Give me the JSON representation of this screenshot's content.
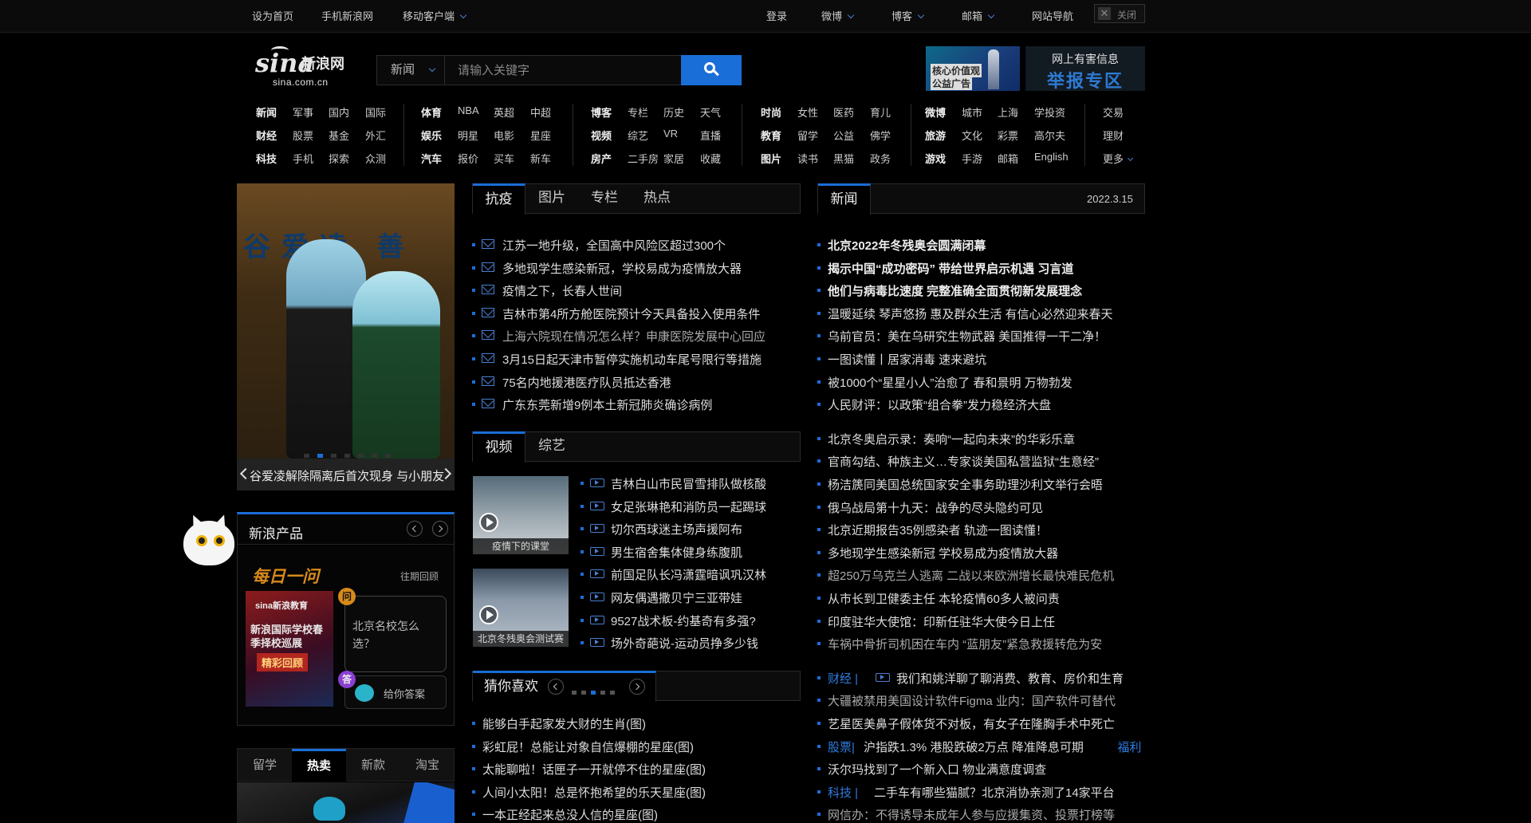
{
  "topbar": {
    "set_home": "设为首页",
    "mobile_sina": "手机新浪网",
    "mobile_client": "移动客户端",
    "login": "登录",
    "weibo": "微博",
    "blog": "博客",
    "mail": "邮箱",
    "site_nav": "网站导航",
    "close": "关闭"
  },
  "logo": {
    "brand": "sina",
    "cn": "新浪网",
    "domain": "sina.com.cn"
  },
  "search": {
    "category": "新闻",
    "placeholder": "请输入关键字"
  },
  "ads": {
    "ad1_line1": "核心价值观",
    "ad1_line2": "公益广告",
    "ad2_line1": "网上有害信息",
    "ad2_line2": "举报专区"
  },
  "nav": {
    "g1": [
      [
        "新闻",
        "军事",
        "国内",
        "国际"
      ],
      [
        "财经",
        "股票",
        "基金",
        "外汇"
      ],
      [
        "科技",
        "手机",
        "探索",
        "众测"
      ]
    ],
    "g2": [
      [
        "体育",
        "NBA",
        "英超",
        "中超"
      ],
      [
        "娱乐",
        "明星",
        "电影",
        "星座"
      ],
      [
        "汽车",
        "报价",
        "买车",
        "新车"
      ]
    ],
    "g3": [
      [
        "博客",
        "专栏",
        "历史",
        "天气"
      ],
      [
        "视频",
        "综艺",
        "VR",
        "直播"
      ],
      [
        "房产",
        "二手房",
        "家居",
        "收藏"
      ]
    ],
    "g4": [
      [
        "时尚",
        "女性",
        "医药",
        "育儿"
      ],
      [
        "教育",
        "留学",
        "公益",
        "佛学"
      ],
      [
        "图片",
        "读书",
        "黑猫",
        "政务"
      ]
    ],
    "g5": [
      [
        "微博",
        "城市",
        "上海",
        "学投资"
      ],
      [
        "旅游",
        "文化",
        "彩票",
        "高尔夫"
      ],
      [
        "游戏",
        "手游",
        "邮箱",
        "English"
      ]
    ],
    "g6": [
      "交易",
      "理财",
      "更多"
    ]
  },
  "slideshow": {
    "banner": "谷爱凌 善",
    "caption": "谷爱凌解除隔离后首次现身 与小朋友合影",
    "active_index": 1,
    "count": 7
  },
  "products": {
    "title": "新浪产品",
    "daily": "每日一问",
    "past": "往期回顾",
    "poster_brand": "sina新浪教育",
    "poster_title": "新浪国际学校春季择校巡展",
    "poster_tag": "精彩回顾",
    "question_badge": "问",
    "answer_badge": "答",
    "question": "北京名校怎么选？",
    "answer": "给你答案"
  },
  "shop_tabs": [
    "留学",
    "热卖",
    "新款",
    "淘宝"
  ],
  "shop_active": 1,
  "center": {
    "tabs": [
      "抗疫",
      "图片",
      "专栏",
      "热点"
    ],
    "news": [
      "江苏一地升级，全国高中风险区超过300个",
      "多地现学生感染新冠，学校易成为疫情放大器",
      "疫情之下，长春人世间",
      "吉林市第4所方舱医院预计今天具备投入使用条件",
      "上海六院现在情况怎么样？申康医院发展中心回应",
      "3月15日起天津市暂停实施机动车尾号限行等措施",
      "75名内地援港医疗队员抵达香港",
      "广东东莞新增9例本土新冠肺炎确诊病例"
    ],
    "video_tabs": [
      "视频",
      "综艺"
    ],
    "video_thumbs": [
      "疫情下的课堂",
      "北京冬残奥会测试赛"
    ],
    "videos": [
      "吉林白山市民冒雪排队做核酸",
      "女足张琳艳和消防员一起踢球",
      "切尔西球迷主场声援阿布",
      "男生宿舍集体健身练腹肌",
      "前国足队长冯潇霆暗讽巩汉林",
      "网友偶遇撒贝宁三亚带娃",
      "9527战术板-约基奇有多强?",
      "场外奇葩说-运动员挣多少钱"
    ],
    "guess_title": "猜你喜欢",
    "guess": [
      "能够白手起家发大财的生肖(图)",
      "彩虹屁！总能让对象自信爆棚的星座(图)",
      "太能聊啦！话匣子一开就停不住的星座(图)",
      "人间小太阳！总是怀抱希望的乐天星座(图)",
      "一本正经起来总没人信的星座(图)"
    ]
  },
  "right": {
    "tab": "新闻",
    "date": "2022.3.15",
    "block1": [
      {
        "t": "北京2022年冬残奥会圆满闭幕",
        "s": "b"
      },
      {
        "t": "揭示中国“成功密码” 带给世界启示机遇 习言道",
        "s": "b"
      },
      {
        "t": "他们与病毒比速度 完整准确全面贯彻新发展理念",
        "s": "b"
      },
      {
        "t": "温暖延续 琴声悠扬 惠及群众生活 有信心必然迎来春天",
        "s": "n"
      },
      {
        "t": "乌前官员：美在乌研究生物武器 美国推得一干二净！",
        "s": "n"
      },
      {
        "t": "一图读懂丨居家消毒 速来避坑",
        "s": "n"
      },
      {
        "t": "被1000个“星星小人”治愈了 春和景明 万物勃发",
        "s": "n"
      },
      {
        "t": "人民财评：以政策“组合拳”发力稳经济大盘",
        "s": "n"
      }
    ],
    "block2": [
      {
        "t": "北京冬奥启示录：奏响“一起向未来”的华彩乐章",
        "s": "n"
      },
      {
        "t": "官商勾结、种族主义…专家谈美国私营监狱“生意经”",
        "s": "n"
      },
      {
        "t": "杨洁篪同美国总统国家安全事务助理沙利文举行会晤",
        "s": "n"
      },
      {
        "t": "俄乌战局第十九天：战争的尽头隐约可见",
        "s": "n"
      },
      {
        "t": "北京近期报告35例感染者 轨迹一图读懂！",
        "s": "n"
      },
      {
        "t": "多地现学生感染新冠 学校易成为疫情放大器",
        "s": "n"
      },
      {
        "t": "超250万乌克兰人逃离 二战以来欧洲增长最快难民危机",
        "s": "g"
      },
      {
        "t": "从市长到卫健委主任 本轮疫情60多人被问责",
        "s": "n"
      },
      {
        "t": "印度驻华大使馆：印新任驻华大使今日上任",
        "s": "n"
      },
      {
        "t": "车祸中骨折司机困在车内 “蓝朋友”紧急救援转危为安",
        "s": "g"
      }
    ],
    "block3": [
      {
        "pre": "财经 |",
        "t": "我们和姚洋聊了聊消费、教育、房价和生育",
        "s": "n",
        "icon": "tv"
      },
      {
        "pre": "",
        "t": "大疆被禁用美国设计软件Figma 业内：国产软件可替代",
        "s": "g"
      },
      {
        "pre": "",
        "t": "艺星医美鼻子假体货不对板，有女子在隆胸手术中死亡",
        "s": "n"
      },
      {
        "pre": "股票|",
        "t": "沪指跌1.3% 港股跌破2万点 降准降息可期",
        "post": "福利",
        "s": "n"
      },
      {
        "pre": "",
        "t": "沃尔玛找到了一个新入口 物业满意度调查",
        "s": "n"
      },
      {
        "pre": "科技 |",
        "t": "二手车有哪些猫腻？北京消协亲测了14家平台",
        "s": "n"
      },
      {
        "pre": "",
        "t": "网信办：不得诱导未成年人参与应援集资、投票打榜等",
        "s": "g"
      }
    ]
  },
  "colors": {
    "accent": "#1a6ed8",
    "background": "#000000",
    "link_blue": "#2f7de1"
  }
}
